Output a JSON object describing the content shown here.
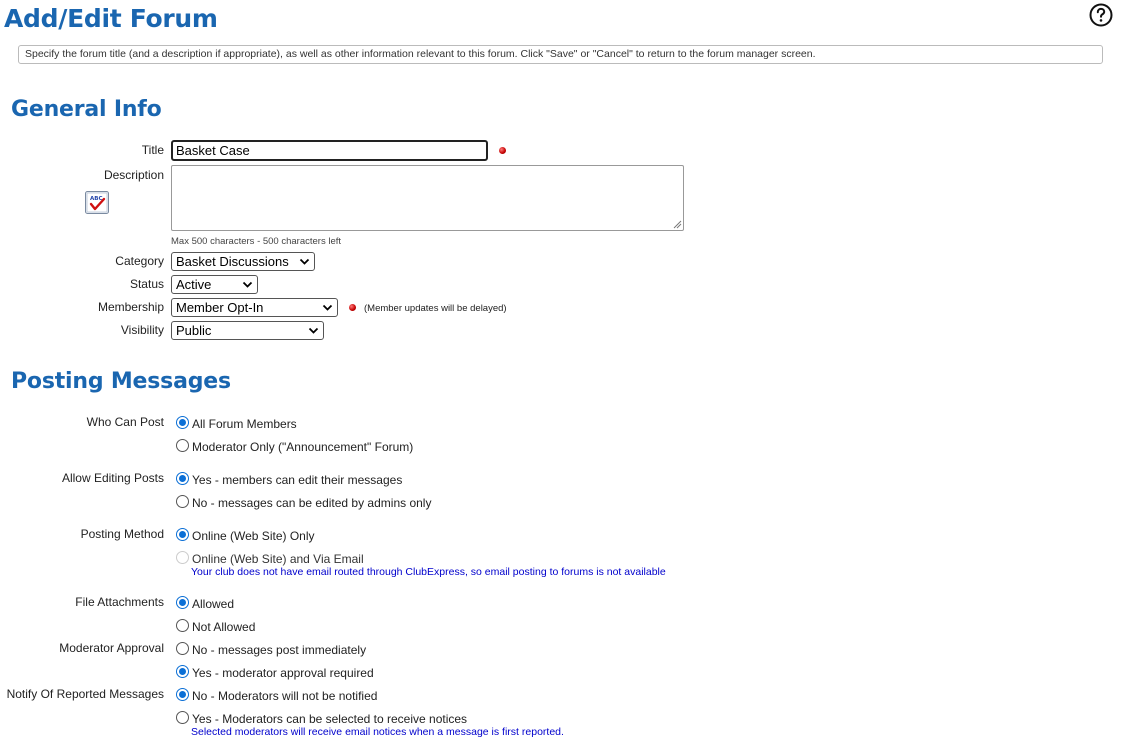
{
  "page": {
    "title": "Add/Edit Forum",
    "instructions": "Specify the forum title (and a description if appropriate), as well as other information relevant to this forum. Click \"Save\" or \"Cancel\" to return to the forum manager screen."
  },
  "general": {
    "heading": "General Info",
    "title_label": "Title",
    "title_value": "Basket Case",
    "description_label": "Description",
    "description_value": "",
    "description_hint": "Max 500 characters - 500 characters left",
    "category_label": "Category",
    "category_value": "Basket Discussions",
    "status_label": "Status",
    "status_value": "Active",
    "membership_label": "Membership",
    "membership_value": "Member Opt-In",
    "membership_note": "(Member updates will be delayed)",
    "visibility_label": "Visibility",
    "visibility_value": "Public"
  },
  "posting": {
    "heading": "Posting Messages",
    "who_can_post_label": "Who Can Post",
    "who_can_post_options": [
      "All Forum Members",
      "Moderator Only (\"Announcement\" Forum)"
    ],
    "allow_editing_label": "Allow Editing Posts",
    "allow_editing_options": [
      "Yes - members can edit their messages",
      "No - messages can be edited by admins only"
    ],
    "posting_method_label": "Posting Method",
    "posting_method_options": [
      "Online (Web Site) Only",
      "Online (Web Site) and Via Email"
    ],
    "posting_method_note": "Your club does not have email routed through ClubExpress, so email posting to forums is not available",
    "attachments_label": "File Attachments",
    "attachments_options": [
      "Allowed",
      "Not Allowed"
    ],
    "moderator_label": "Moderator Approval",
    "moderator_options": [
      "No - messages post immediately",
      "Yes - moderator approval required"
    ],
    "notify_label": "Notify Of Reported Messages",
    "notify_options": [
      "No - Moderators will not be notified",
      "Yes - Moderators can be selected to receive notices"
    ],
    "notify_note": "Selected moderators will receive email notices when a message is first reported."
  },
  "colors": {
    "heading_blue": "#1a66b0",
    "radio_blue": "#0b6fd6",
    "note_blue": "#0000cc",
    "required_red": "#c40000"
  },
  "icons": [
    "help-icon",
    "spellcheck-icon",
    "required-icon",
    "chevron-down-icon"
  ]
}
